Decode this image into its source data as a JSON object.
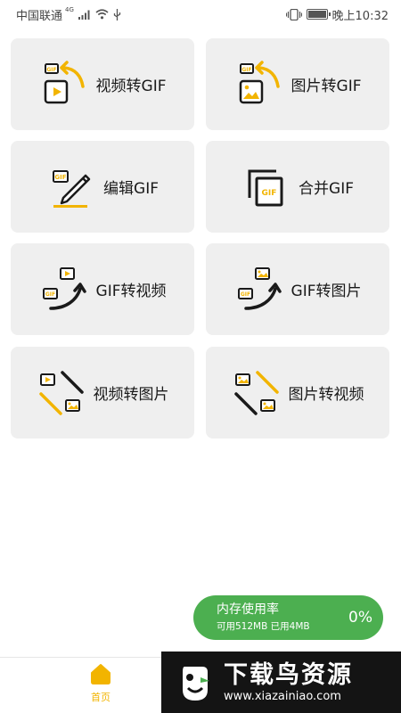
{
  "status_bar": {
    "carrier": "中国联通",
    "network": "4G",
    "time": "晚上10:32"
  },
  "tools": [
    {
      "label": "视频转GIF",
      "icon": "video-to-gif-icon"
    },
    {
      "label": "图片转GIF",
      "icon": "image-to-gif-icon"
    },
    {
      "label": "编辑GIF",
      "icon": "edit-gif-icon"
    },
    {
      "label": "合并GIF",
      "icon": "merge-gif-icon"
    },
    {
      "label": "GIF转视频",
      "icon": "gif-to-video-icon"
    },
    {
      "label": "GIF转图片",
      "icon": "gif-to-image-icon"
    },
    {
      "label": "视频转图片",
      "icon": "video-to-image-icon"
    },
    {
      "label": "图片转视频",
      "icon": "image-to-video-icon"
    }
  ],
  "memory": {
    "title": "内存使用率",
    "detail": "可用512MB 已用4MB",
    "percent": "0%"
  },
  "nav": {
    "home_label": "首页"
  },
  "watermark": {
    "title": "下载鸟资源",
    "url": "www.xiazainiao.com"
  },
  "colors": {
    "accent": "#f2b400",
    "card_bg": "#efefef",
    "memory_green": "#4caf50"
  }
}
